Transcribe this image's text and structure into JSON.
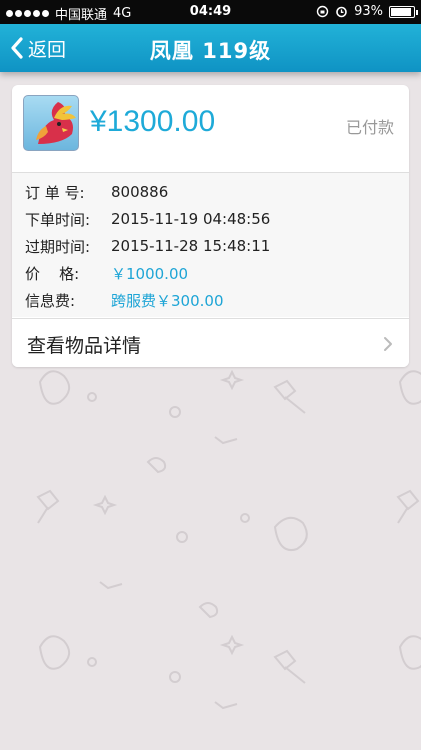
{
  "status_bar": {
    "carrier": "中国联通",
    "network": "4G",
    "time": "04:49",
    "battery": "93%",
    "battery_level": 0.93
  },
  "nav": {
    "back_label": "返回",
    "title": "凤凰 119级"
  },
  "order": {
    "price": "¥1300.00",
    "status": "已付款",
    "rows": [
      {
        "label": "订 单 号:",
        "value": "800886"
      },
      {
        "label": "下单时间:",
        "value": "2015-11-19 04:48:56"
      },
      {
        "label": "过期时间:",
        "value": "2015-11-28 15:48:11"
      },
      {
        "label": "价    格:",
        "value": "￥1000.00"
      },
      {
        "label": "信息费:",
        "value": "跨服费￥300.00"
      }
    ],
    "detail_link": "查看物品详情"
  },
  "colors": {
    "accent": "#1eaad8",
    "nav_bg": "#1aa4d2",
    "background": "#e9e4e6"
  },
  "icons": [
    "back-chevron-icon",
    "chevron-right-icon",
    "alarm-icon",
    "lock-rotation-icon",
    "battery-icon",
    "signal-dots-icon"
  ]
}
